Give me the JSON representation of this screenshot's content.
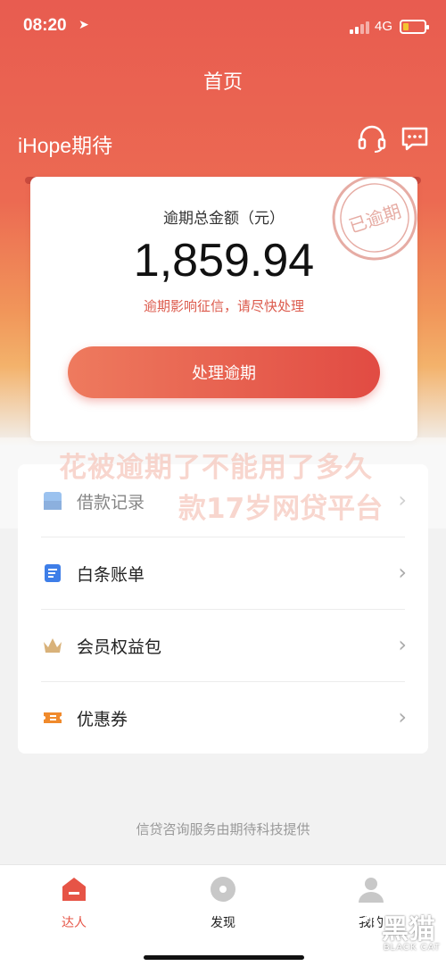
{
  "status_bar": {
    "time": "08:20",
    "network": "4G",
    "battery_level": 0.25
  },
  "nav": {
    "title": "首页"
  },
  "brand": {
    "name": "iHope期待"
  },
  "overdue_card": {
    "label": "逾期总金额（元）",
    "amount": "1,859.94",
    "warning": "逾期影响征信，请尽快处理",
    "action_button": "处理逾期",
    "stamp_text": "已逾期"
  },
  "overlay_text": {
    "line1": "花被逾期了不能用了多久",
    "line2": "款17岁网贷平台"
  },
  "menu": {
    "items": [
      {
        "label": "借款记录",
        "icon": "loan-record-icon"
      },
      {
        "label": "白条账单",
        "icon": "bill-icon"
      },
      {
        "label": "会员权益包",
        "icon": "crown-icon"
      },
      {
        "label": "优惠券",
        "icon": "coupon-icon"
      }
    ]
  },
  "footer_text": "信贷咨询服务由期待科技提供",
  "tabs": [
    {
      "label": "达人",
      "icon": "home-icon",
      "active": true
    },
    {
      "label": "发现",
      "icon": "discover-icon",
      "active": false
    },
    {
      "label": "我的",
      "icon": "profile-icon",
      "active": false
    }
  ],
  "watermark": {
    "name": "黑猫",
    "sub": "BLACK CAT"
  },
  "colors": {
    "accent": "#e65446",
    "hero_top": "#e85c50",
    "hero_bottom": "#f3b26b",
    "warning_text": "#dc5a4c"
  }
}
